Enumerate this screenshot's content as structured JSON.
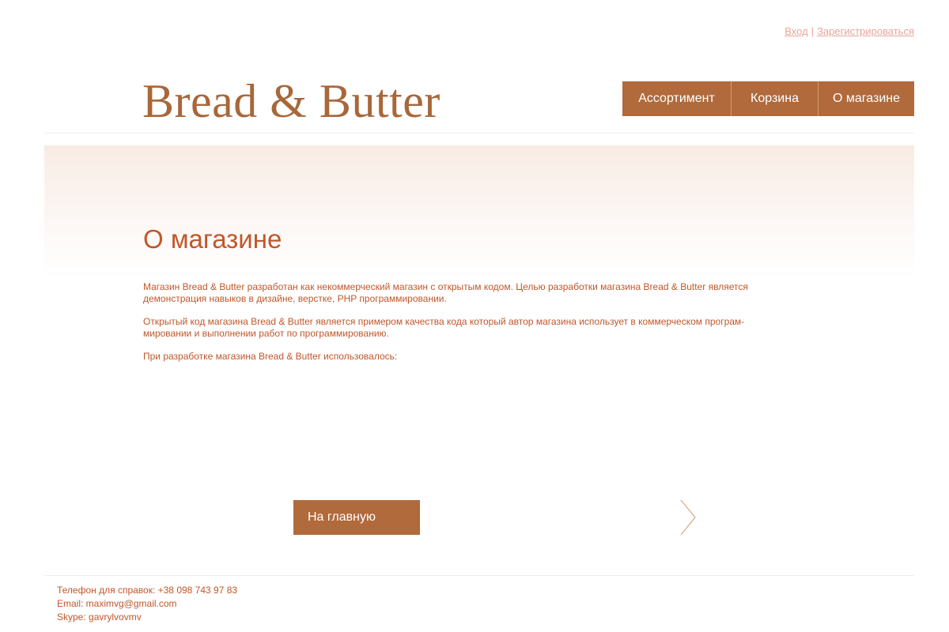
{
  "auth": {
    "login": "Вход",
    "separator": "|",
    "register": "Зарегистрироваться"
  },
  "logo": {
    "text": "Bread & Butter"
  },
  "nav": {
    "items": [
      {
        "label": "Ассортимент"
      },
      {
        "label": "Корзина"
      },
      {
        "label": "О магазине"
      }
    ]
  },
  "main": {
    "title": "О магазине",
    "paragraphs": [
      "Магазин Bread & Butter разработан как некоммерческий магазин с открытым кодом. Целью разработки магазина Bread & Butter является демонстрация навыков в дизайне, верстке, PHP программировании.",
      "Открытый код магазина Bread & Butter является примером качества кода который автор магазина использует в коммерческом програм-мировании и выполнении работ по программированию.",
      "При разработке магазина Bread & Butter использовалось:"
    ],
    "home_button": "На главную"
  },
  "footer": {
    "phone": "Телефон для справок: +38 098 743 97 83",
    "email": "Email: maximvg@gmail.com",
    "skype": "Skype: gavrylvovmv"
  },
  "colors": {
    "accent": "#b06a3b",
    "text": "#c0572a",
    "link": "#e8a59a"
  }
}
